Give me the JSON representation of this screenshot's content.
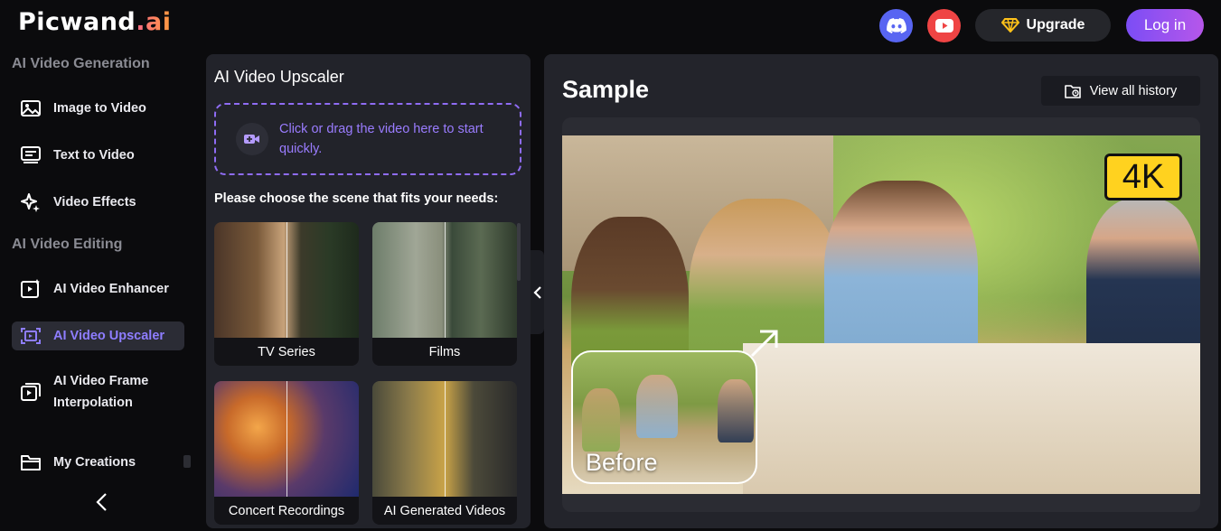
{
  "header": {
    "logo_main": "Picwand",
    "logo_suffix": ".ai",
    "upgrade_label": "Upgrade",
    "login_label": "Log in"
  },
  "sidebar": {
    "section_generation": "AI Video Generation",
    "section_editing": "AI Video Editing",
    "items": [
      {
        "label": "Image to Video",
        "icon": "image-icon"
      },
      {
        "label": "Text to Video",
        "icon": "text-icon"
      },
      {
        "label": "Video Effects",
        "icon": "sparkle-icon"
      },
      {
        "label": "AI Video Enhancer",
        "icon": "enhance-icon"
      },
      {
        "label": "AI Video Upscaler",
        "icon": "upscale-icon",
        "active": true
      },
      {
        "label": "AI Video Frame Interpolation",
        "icon": "frames-icon"
      },
      {
        "label": "My Creations",
        "icon": "folder-icon"
      }
    ]
  },
  "upscaler": {
    "title": "AI Video Upscaler",
    "drop_text": "Click or drag the video here to start quickly.",
    "choose_text": "Please choose the scene that fits your needs:",
    "scenes": [
      "TV Series",
      "Films",
      "Concert Recordings",
      "AI Generated Videos"
    ]
  },
  "sample": {
    "title": "Sample",
    "history_label": "View all history",
    "badge": "4K",
    "before_label": "Before"
  },
  "colors": {
    "accent": "#8f6cf4",
    "discord": "#5865f2",
    "youtube": "#ef4444",
    "badge": "#ffd21f"
  }
}
